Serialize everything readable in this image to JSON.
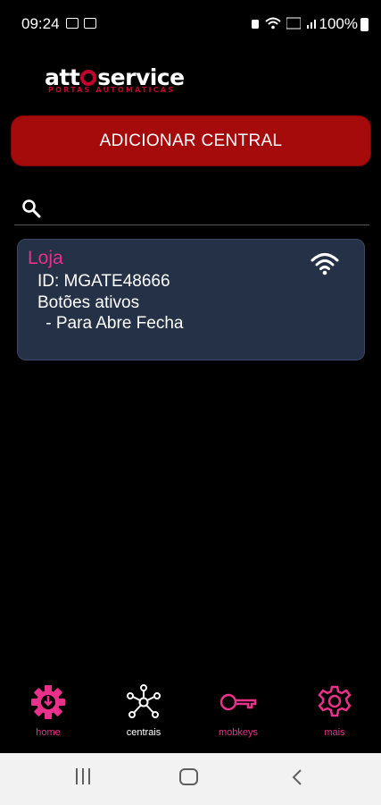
{
  "status_bar": {
    "time": "09:24",
    "battery": "100%"
  },
  "logo": {
    "main_left": "att",
    "main_right": "service",
    "subtitle": "PORTAS AUTOMÁTICAS"
  },
  "add_button": {
    "label": "ADICIONAR CENTRAL"
  },
  "search": {
    "placeholder": "",
    "value": ""
  },
  "devices": [
    {
      "name": "Loja",
      "id_line": "ID: MGATE48666",
      "buttons_title": "Botões ativos",
      "buttons": [
        " - Para Abre Fecha"
      ],
      "status_icon": "wifi-icon"
    }
  ],
  "bottom_nav": {
    "items": [
      {
        "label": "home",
        "icon": "gear-icon",
        "color": "#e9308a"
      },
      {
        "label": "centrais",
        "icon": "network-icon",
        "color": "#ffffff"
      },
      {
        "label": "mobkeys",
        "icon": "key-icon",
        "color": "#e9308a"
      },
      {
        "label": "mais",
        "icon": "settings-icon",
        "color": "#e9308a"
      }
    ],
    "active": "centrais"
  },
  "colors": {
    "accent_red": "#a60b0b",
    "accent_pink": "#e9308a",
    "card_bg": "#243147"
  }
}
